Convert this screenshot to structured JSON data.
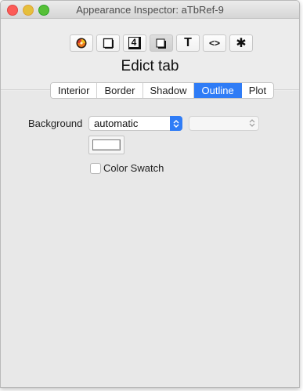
{
  "window": {
    "title": "Appearance Inspector: aTbRef-9"
  },
  "toolbar": {
    "tools": [
      {
        "icon": "color-wheel-icon"
      },
      {
        "icon": "square-frame-icon"
      },
      {
        "icon": "number-badge-icon",
        "text": "4"
      },
      {
        "icon": "shadow-square-icon"
      },
      {
        "icon": "text-icon",
        "text": "T"
      },
      {
        "icon": "code-brackets-icon",
        "text": "<>"
      },
      {
        "icon": "gear-icon",
        "text": "✱"
      }
    ]
  },
  "heading": "Edict tab",
  "tabs": [
    {
      "label": "Interior",
      "active": false
    },
    {
      "label": "Border",
      "active": false
    },
    {
      "label": "Shadow",
      "active": false
    },
    {
      "label": "Outline",
      "active": true
    },
    {
      "label": "Plot",
      "active": false
    }
  ],
  "form": {
    "background_label": "Background",
    "background_value": "automatic",
    "secondary_value": "",
    "color_swatch_label": "Color Swatch",
    "color_swatch_checked": false
  },
  "colors": {
    "accent": "#2f7cf6",
    "panel": "#e8e8e8",
    "close": "#fc5b57",
    "minimize": "#e5bf3c",
    "maximize": "#57c038"
  }
}
